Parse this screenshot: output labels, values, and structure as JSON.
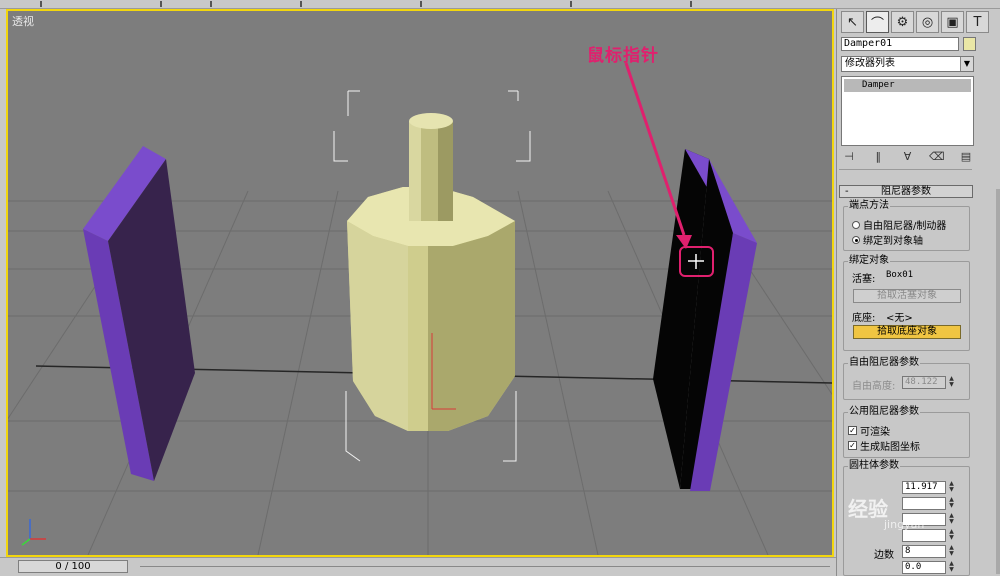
{
  "viewport": {
    "label": "透视",
    "annotation": "鼠标指针"
  },
  "panel": {
    "tabs": [
      "pointer-icon",
      "bend-icon",
      "hierarchy-icon",
      "motion-icon",
      "display-icon",
      "utilities-icon"
    ],
    "object_name": "Damper01",
    "object_color": "#eae7a6",
    "modifier_list": "修改器列表",
    "stack_item": "Damper",
    "rollout_title": "阻尼器参数",
    "endpoint_group": {
      "title": "端点方法",
      "option1": "自由阻尼器/制动器",
      "option2": "绑定到对象轴",
      "selected": 2
    },
    "bind_group": {
      "title": "绑定对象",
      "piston_label": "活塞:",
      "piston_value": "Box01",
      "pick_piston": "拾取活塞对象",
      "base_label": "底座:",
      "base_value": "<无>",
      "pick_base": "拾取底座对象"
    },
    "free_group": {
      "title": "自由阻尼器参数",
      "height_label": "自由高度:",
      "height_value": "48.122"
    },
    "common_group": {
      "title": "公用阻尼器参数",
      "renderable": "可渲染",
      "gen_coords": "生成贴图坐标"
    },
    "cylinder_group": {
      "title": "圆柱体参数",
      "diameter_value": "11.917",
      "sides_label": "边数",
      "sides_value": "8",
      "fillet_value": "0.0"
    }
  },
  "timebar": {
    "position": "0 / 100",
    "frame_fraction": 0.0
  },
  "watermark": {
    "brand": "经验",
    "sub": "jingyan"
  },
  "colors": {
    "viewport_bg": "#7d7d7d",
    "active_border": "#f2d60e",
    "purple_face": "#7a4ccc",
    "cylinder": "#dedca0",
    "callout": "#e0206e"
  }
}
